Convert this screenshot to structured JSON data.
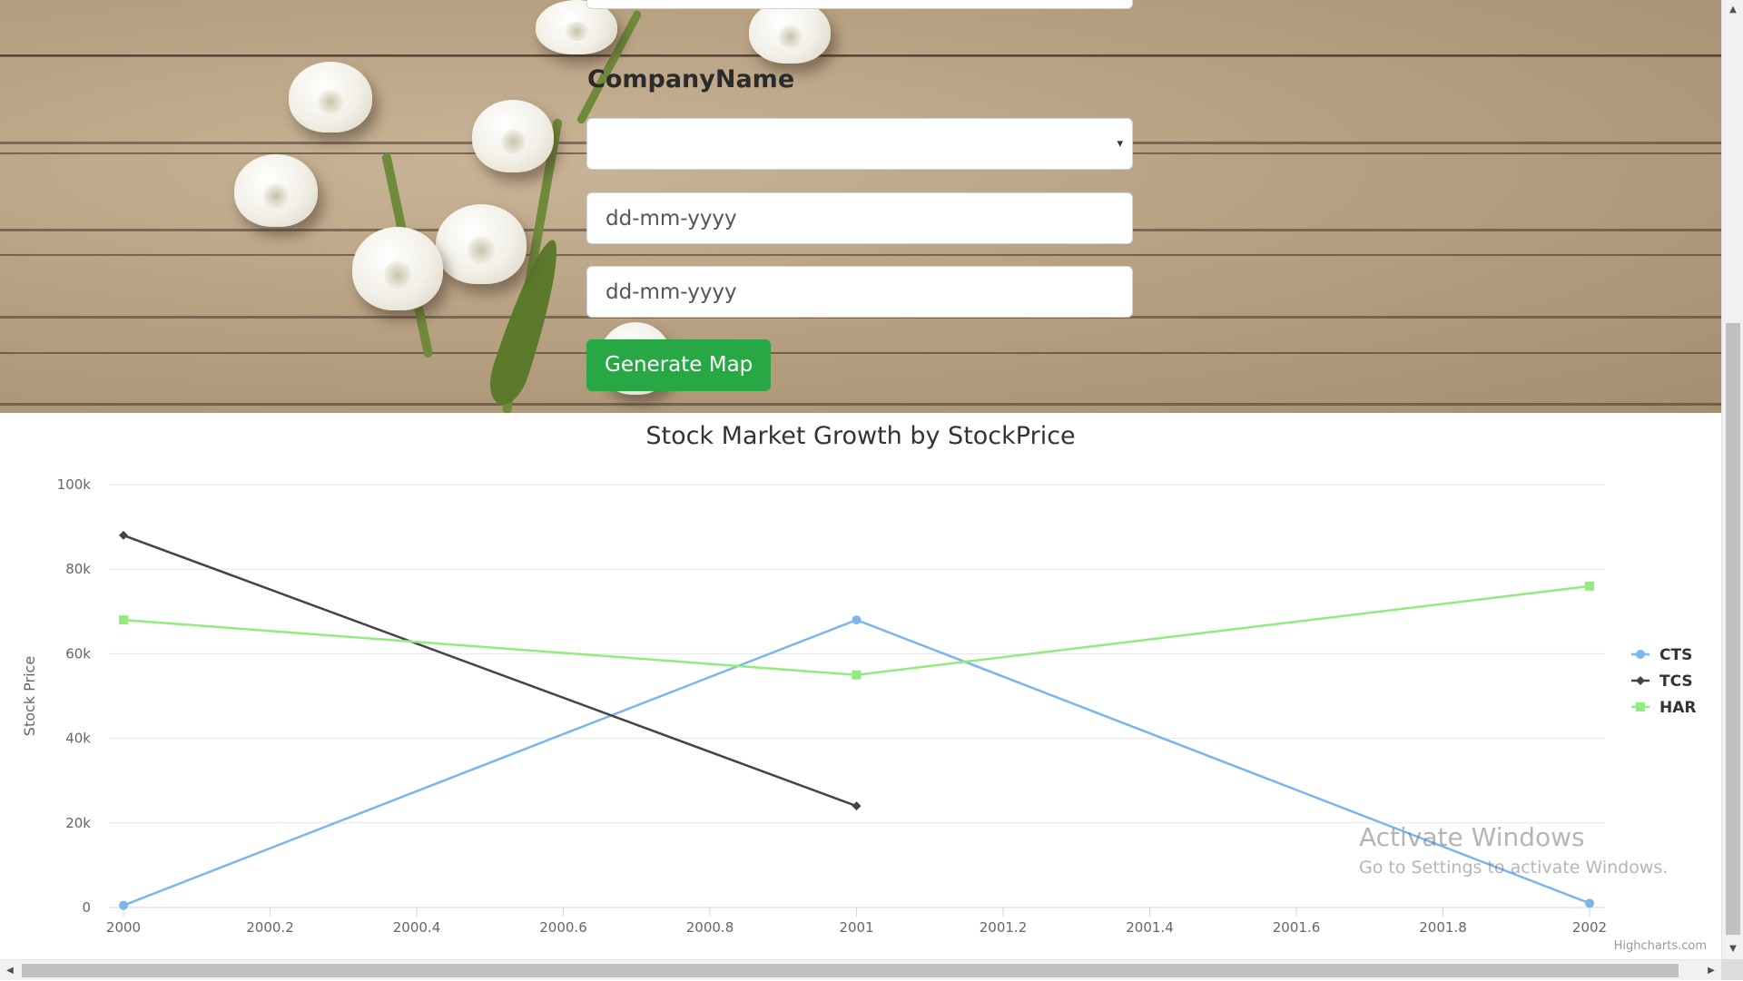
{
  "form": {
    "company_label": "CompanyName",
    "company_select_value": "",
    "start_date_placeholder": "dd-mm-yyyy",
    "end_date_placeholder": "dd-mm-yyyy",
    "generate_button": "Generate Map",
    "select_caret": "▾"
  },
  "colors": {
    "button": "#28a745",
    "cts": "#7cb5ec",
    "tcs": "#434348",
    "har": "#90ed7d"
  },
  "chart_data": {
    "type": "line",
    "title": "Stock Market Growth by StockPrice",
    "xlabel": "",
    "ylabel": "Stock Price",
    "xlim": [
      2000,
      2002
    ],
    "ylim": [
      0,
      100000
    ],
    "x_ticks": [
      "2000",
      "2000.2",
      "2000.4",
      "2000.6",
      "2000.8",
      "2001",
      "2001.2",
      "2001.4",
      "2001.6",
      "2001.8",
      "2002"
    ],
    "y_ticks": [
      "0",
      "20k",
      "40k",
      "60k",
      "80k",
      "100k"
    ],
    "grid": true,
    "legend_position": "right",
    "series": [
      {
        "name": "CTS",
        "marker": "circle",
        "color": "#7cb5ec",
        "points": [
          [
            2000,
            500
          ],
          [
            2001,
            68000
          ],
          [
            2002,
            1000
          ]
        ]
      },
      {
        "name": "TCS",
        "marker": "diamond",
        "color": "#434348",
        "points": [
          [
            2000,
            88000
          ],
          [
            2001,
            24000
          ]
        ]
      },
      {
        "name": "HAR",
        "marker": "square",
        "color": "#90ed7d",
        "points": [
          [
            2000,
            68000
          ],
          [
            2001,
            55000
          ],
          [
            2002,
            76000
          ]
        ]
      }
    ],
    "credits": "Highcharts.com"
  },
  "watermark": {
    "title": "Activate Windows",
    "subtitle": "Go to Settings to activate Windows."
  },
  "scrollbars": {
    "up": "▲",
    "down": "▼",
    "left": "◀",
    "right": "▶"
  }
}
